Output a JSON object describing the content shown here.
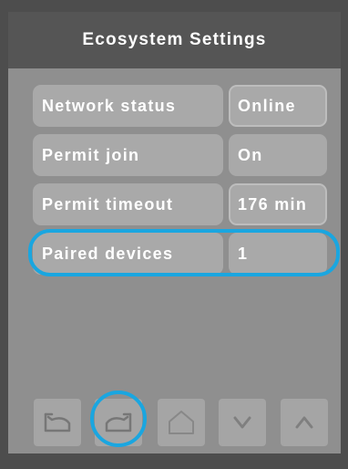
{
  "header": {
    "title": "Ecosystem Settings"
  },
  "rows": [
    {
      "label": "Network status",
      "value": "Online"
    },
    {
      "label": "Permit join",
      "value": "On"
    },
    {
      "label": "Permit timeout",
      "value": "176 min"
    },
    {
      "label": "Paired devices",
      "value": "1"
    }
  ],
  "selected_row": "Paired devices",
  "toolbar": {
    "buttons": [
      {
        "name": "undo",
        "icon": "undo-icon"
      },
      {
        "name": "redo",
        "icon": "redo-icon",
        "highlighted": true
      },
      {
        "name": "home",
        "icon": "home-icon"
      },
      {
        "name": "down",
        "icon": "chevron-down-icon"
      },
      {
        "name": "up",
        "icon": "chevron-up-icon"
      }
    ]
  },
  "colors": {
    "background": "#4d4d4d",
    "header": "#555555",
    "panel": "#8f8f8f",
    "cell": "#a9a9a9",
    "highlight": "#1aa6e0",
    "text": "#ffffff"
  }
}
